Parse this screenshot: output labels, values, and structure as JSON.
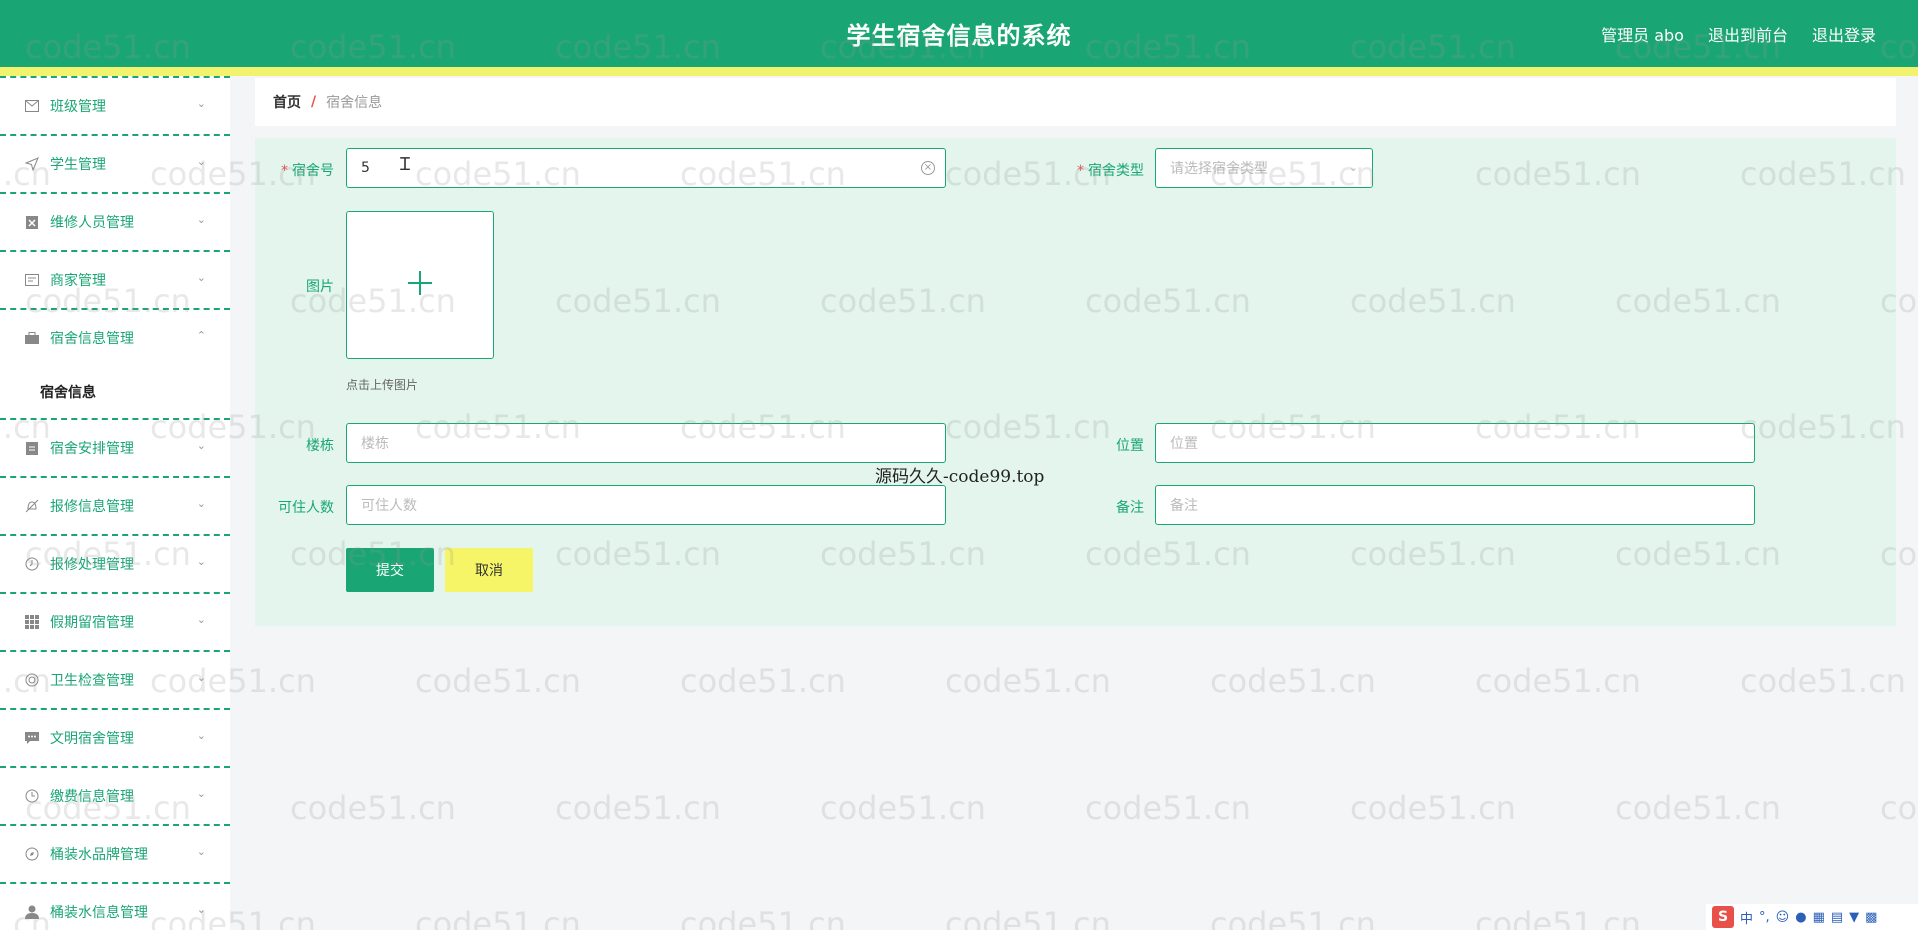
{
  "header": {
    "title": "学生宿舍信息的系统",
    "admin_label": "管理员 abo",
    "to_front": "退出到前台",
    "logout": "退出登录"
  },
  "sidebar": {
    "items": [
      {
        "label": "班级管理",
        "icon": "mail-icon"
      },
      {
        "label": "学生管理",
        "icon": "send-icon"
      },
      {
        "label": "维修人员管理",
        "icon": "clipboard-x-icon"
      },
      {
        "label": "商家管理",
        "icon": "card-icon"
      },
      {
        "label": "宿舍信息管理",
        "icon": "briefcase-icon",
        "open": true,
        "children": [
          "宿舍信息"
        ]
      },
      {
        "label": "宿舍安排管理",
        "icon": "clipboard-icon"
      },
      {
        "label": "报修信息管理",
        "icon": "bell-off-icon"
      },
      {
        "label": "报修处理管理",
        "icon": "clock-icon"
      },
      {
        "label": "假期留宿管理",
        "icon": "grid-icon"
      },
      {
        "label": "卫生检查管理",
        "icon": "circle-icon"
      },
      {
        "label": "文明宿舍管理",
        "icon": "chat-icon"
      },
      {
        "label": "缴费信息管理",
        "icon": "time-icon"
      },
      {
        "label": "桶装水品牌管理",
        "icon": "compass-icon"
      },
      {
        "label": "桶装水信息管理",
        "icon": "user-icon"
      }
    ]
  },
  "breadcrumb": {
    "home": "首页",
    "separator": "/",
    "current": "宿舍信息"
  },
  "form": {
    "room_no_label": "宿舍号",
    "room_no_value": "5",
    "room_type_label": "宿舍类型",
    "room_type_placeholder": "请选择宿舍类型",
    "image_label": "图片",
    "upload_hint": "点击上传图片",
    "building_label": "楼栋",
    "building_placeholder": "楼栋",
    "location_label": "位置",
    "location_placeholder": "位置",
    "capacity_label": "可住人数",
    "capacity_placeholder": "可住人数",
    "remark_label": "备注",
    "remark_placeholder": "备注",
    "submit": "提交",
    "cancel": "取消"
  },
  "overlay_text": "源码久久-code99.top",
  "watermark_text": "code51.cn",
  "ime": {
    "logo": "S",
    "mode": "中"
  },
  "colors": {
    "primary": "#1aa674",
    "stripe": "#f1f36e",
    "form_bg": "#e3f5ed",
    "cancel_bg": "#f5f567",
    "required": "#e8514a"
  }
}
